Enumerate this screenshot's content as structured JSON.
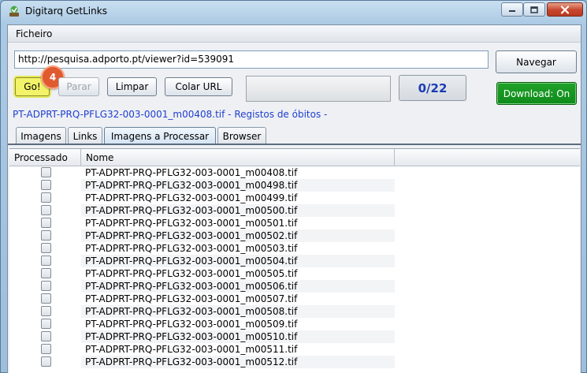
{
  "window": {
    "title": "Digitarq GetLinks"
  },
  "menu": {
    "items": [
      "Ficheiro"
    ]
  },
  "toolbar": {
    "url_value": "http://pesquisa.adporto.pt/viewer?id=539091",
    "navegar_label": "Navegar",
    "go_label": "Go!",
    "parar_label": "Parar",
    "limpar_label": "Limpar",
    "colar_label": "Colar URL",
    "counter": "0/22",
    "download_label": "Download: On",
    "step_badge": "4"
  },
  "status": {
    "text": "PT-ADPRT-PRQ-PFLG32-003-0001_m00408.tif - Registos de óbitos -"
  },
  "tabs": [
    {
      "label": "Imagens",
      "active": false
    },
    {
      "label": "Links",
      "active": false
    },
    {
      "label": "Imagens a Processar",
      "active": true
    },
    {
      "label": "Browser",
      "active": false
    }
  ],
  "table": {
    "columns": [
      "Processado",
      "Nome"
    ],
    "rows": [
      {
        "processed": false,
        "name": "PT-ADPRT-PRQ-PFLG32-003-0001_m00408.tif"
      },
      {
        "processed": false,
        "name": "PT-ADPRT-PRQ-PFLG32-003-0001_m00498.tif"
      },
      {
        "processed": false,
        "name": "PT-ADPRT-PRQ-PFLG32-003-0001_m00499.tif"
      },
      {
        "processed": false,
        "name": "PT-ADPRT-PRQ-PFLG32-003-0001_m00500.tif"
      },
      {
        "processed": false,
        "name": "PT-ADPRT-PRQ-PFLG32-003-0001_m00501.tif"
      },
      {
        "processed": false,
        "name": "PT-ADPRT-PRQ-PFLG32-003-0001_m00502.tif"
      },
      {
        "processed": false,
        "name": "PT-ADPRT-PRQ-PFLG32-003-0001_m00503.tif"
      },
      {
        "processed": false,
        "name": "PT-ADPRT-PRQ-PFLG32-003-0001_m00504.tif"
      },
      {
        "processed": false,
        "name": "PT-ADPRT-PRQ-PFLG32-003-0001_m00505.tif"
      },
      {
        "processed": false,
        "name": "PT-ADPRT-PRQ-PFLG32-003-0001_m00506.tif"
      },
      {
        "processed": false,
        "name": "PT-ADPRT-PRQ-PFLG32-003-0001_m00507.tif"
      },
      {
        "processed": false,
        "name": "PT-ADPRT-PRQ-PFLG32-003-0001_m00508.tif"
      },
      {
        "processed": false,
        "name": "PT-ADPRT-PRQ-PFLG32-003-0001_m00509.tif"
      },
      {
        "processed": false,
        "name": "PT-ADPRT-PRQ-PFLG32-003-0001_m00510.tif"
      },
      {
        "processed": false,
        "name": "PT-ADPRT-PRQ-PFLG32-003-0001_m00511.tif"
      },
      {
        "processed": false,
        "name": "PT-ADPRT-PRQ-PFLG32-003-0001_m00512.tif"
      }
    ]
  },
  "colors": {
    "status_text": "#1f3fd0",
    "counter_text": "#1a3cb3",
    "download_bg": "#0e8a19",
    "go_highlight": "#f3f36a",
    "badge": "#e05a30"
  }
}
